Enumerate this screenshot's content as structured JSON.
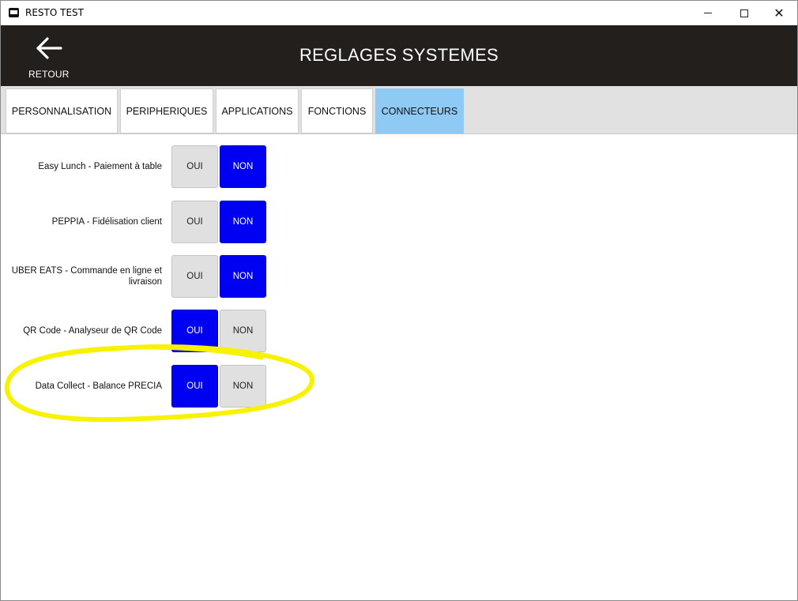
{
  "window": {
    "title": "RESTO TEST"
  },
  "header": {
    "back_label": "RETOUR",
    "title": "REGLAGES SYSTEMES"
  },
  "tabs": [
    {
      "label": "PERSONNALISATION",
      "active": false
    },
    {
      "label": "PERIPHERIQUES",
      "active": false
    },
    {
      "label": "APPLICATIONS",
      "active": false
    },
    {
      "label": "FONCTIONS",
      "active": false
    },
    {
      "label": "CONNECTEURS",
      "active": true
    }
  ],
  "connectors": [
    {
      "label": "Easy Lunch - Paiement à table",
      "oui": "OUI",
      "non": "NON",
      "selected": "NON"
    },
    {
      "label": "PEPPIA - Fidélisation client",
      "oui": "OUI",
      "non": "NON",
      "selected": "NON"
    },
    {
      "label": "UBER EATS - Commande en ligne et livraison",
      "oui": "OUI",
      "non": "NON",
      "selected": "NON"
    },
    {
      "label": "QR Code - Analyseur de QR Code",
      "oui": "OUI",
      "non": "NON",
      "selected": "OUI"
    },
    {
      "label": "Data Collect - Balance PRECIA",
      "oui": "OUI",
      "non": "NON",
      "selected": "OUI"
    }
  ],
  "colors": {
    "header_bg": "#231f1c",
    "active_tab": "#8fcaf5",
    "toggle_on": "#0000f2",
    "toggle_off": "#e0e0e0",
    "highlight": "#f7f200"
  }
}
